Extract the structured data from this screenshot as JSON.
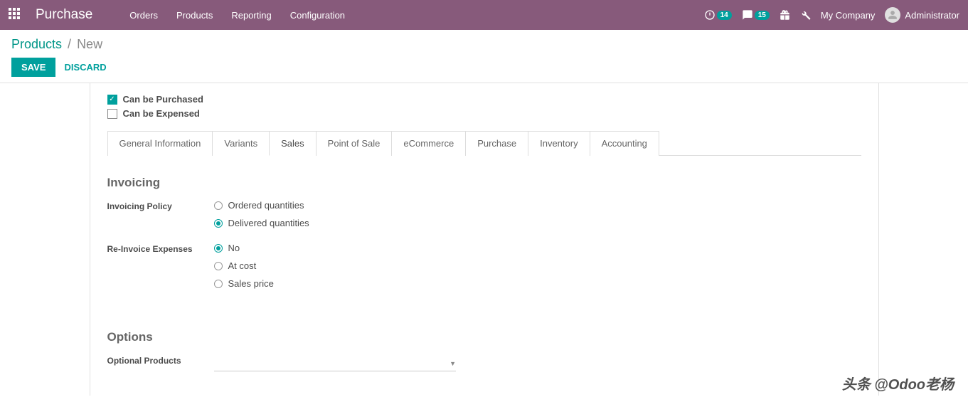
{
  "nav": {
    "brand": "Purchase",
    "menu": [
      "Orders",
      "Products",
      "Reporting",
      "Configuration"
    ],
    "activity_badge": "14",
    "message_badge": "15",
    "company": "My Company",
    "user": "Administrator"
  },
  "breadcrumb": {
    "parent": "Products",
    "current": "New"
  },
  "buttons": {
    "save": "SAVE",
    "discard": "DISCARD"
  },
  "checks": {
    "purchased": "Can be Purchased",
    "expensed": "Can be Expensed"
  },
  "tabs": [
    "General Information",
    "Variants",
    "Sales",
    "Point of Sale",
    "eCommerce",
    "Purchase",
    "Inventory",
    "Accounting"
  ],
  "active_tab": "Sales",
  "sections": {
    "invoicing_title": "Invoicing",
    "invoicing_policy_label": "Invoicing Policy",
    "invoicing_policy_opts": [
      "Ordered quantities",
      "Delivered quantities"
    ],
    "invoicing_policy_selected": "Delivered quantities",
    "reinvoice_label": "Re-Invoice Expenses",
    "reinvoice_opts": [
      "No",
      "At cost",
      "Sales price"
    ],
    "reinvoice_selected": "No",
    "options_title": "Options",
    "optional_products_label": "Optional Products"
  },
  "watermark": "头条 @Odoo老杨"
}
